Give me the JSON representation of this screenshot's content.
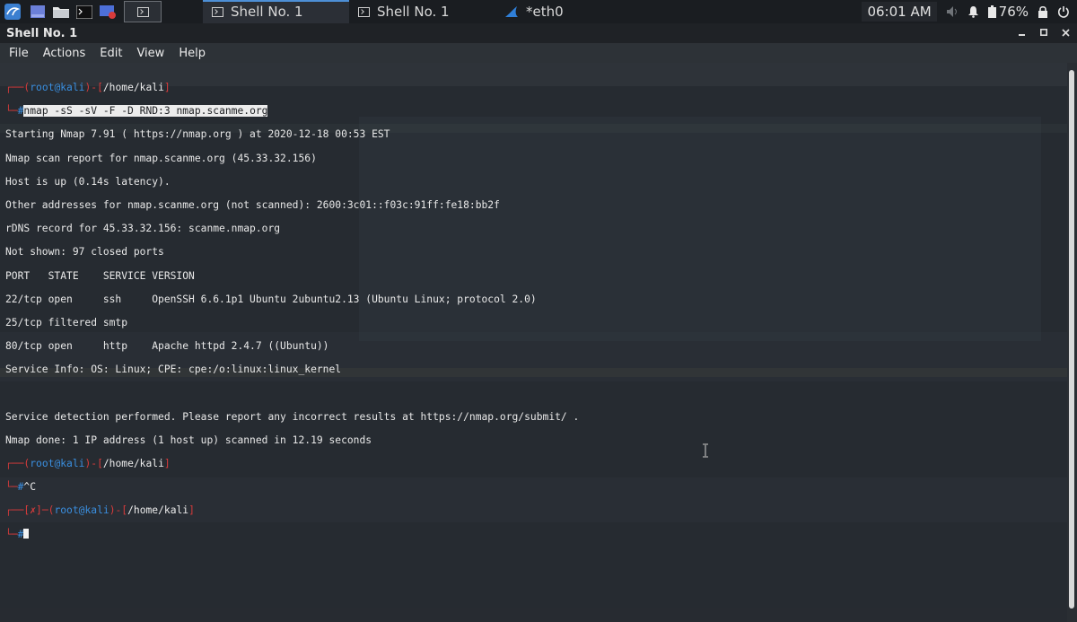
{
  "taskbar": {
    "tasks": [
      {
        "label": "Shell No. 1",
        "icon": "terminal-icon",
        "active": true
      },
      {
        "label": "Shell No. 1",
        "icon": "terminal-icon",
        "active": false
      },
      {
        "label": "*eth0",
        "icon": "wireshark-fin-icon",
        "active": false
      }
    ],
    "clock": "06:01 AM",
    "battery": "76%",
    "accent_color": "#4d8fd6"
  },
  "window": {
    "title": "Shell No. 1"
  },
  "menu": [
    "File",
    "Actions",
    "Edit",
    "View",
    "Help"
  ],
  "terminal": {
    "user": "root",
    "host": "kali",
    "cwd": "/home/kali",
    "command": "nmap -sS -sV -F -D RND:3 nmap.scanme.org",
    "output": [
      "Starting Nmap 7.91 ( https://nmap.org ) at 2020-12-18 00:53 EST",
      "Nmap scan report for nmap.scanme.org (45.33.32.156)",
      "Host is up (0.14s latency).",
      "Other addresses for nmap.scanme.org (not scanned): 2600:3c01::f03c:91ff:fe18:bb2f",
      "rDNS record for 45.33.32.156: scanme.nmap.org",
      "Not shown: 97 closed ports",
      "PORT   STATE    SERVICE VERSION",
      "22/tcp open     ssh     OpenSSH 6.6.1p1 Ubuntu 2ubuntu2.13 (Ubuntu Linux; protocol 2.0)",
      "25/tcp filtered smtp",
      "80/tcp open     http    Apache httpd 2.4.7 ((Ubuntu))",
      "Service Info: OS: Linux; CPE: cpe:/o:linux:linux_kernel",
      "",
      "Service detection performed. Please report any incorrect results at https://nmap.org/submit/ .",
      "Nmap done: 1 IP address (1 host up) scanned in 12.19 seconds"
    ],
    "interrupt": "^C",
    "error_mark": "✗",
    "prompt_char": "#",
    "colors": {
      "prompt_red": "#d83b3b",
      "prompt_blue": "#3a8fe0"
    }
  }
}
